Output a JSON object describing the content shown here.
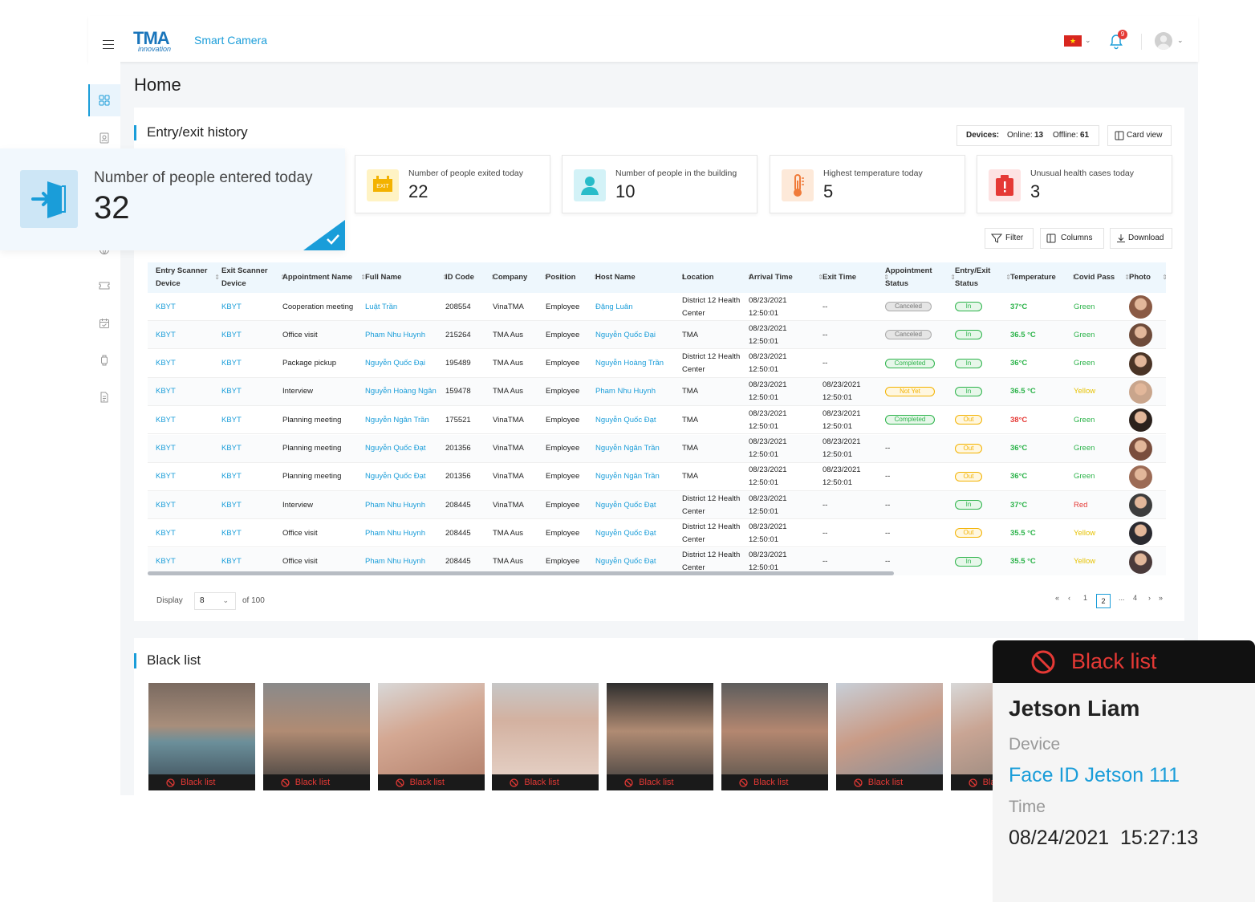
{
  "header": {
    "logo_text": "TMA",
    "logo_sub": "innovation",
    "app_name": "Smart Camera",
    "notification_count": "9"
  },
  "page": {
    "title": "Home"
  },
  "entry_exit": {
    "title": "Entry/exit history",
    "devices_label": "Devices:",
    "online_label": "Online:",
    "online_value": "13",
    "offline_label": "Offline:",
    "offline_value": "61",
    "card_view_label": "Card view",
    "stats": [
      {
        "label": "Number of people entered today",
        "value": "32",
        "icon": "enter-door-icon"
      },
      {
        "label": "Number of people exited today",
        "value": "22",
        "icon": "exit-sign-icon"
      },
      {
        "label": "Number of people in the building",
        "value": "10",
        "icon": "person-icon"
      },
      {
        "label": "Highest temperature today",
        "value": "5",
        "icon": "thermometer-icon"
      },
      {
        "label": "Unusual health cases today",
        "value": "3",
        "icon": "alert-box-icon"
      }
    ],
    "toolbar": {
      "filter": "Filter",
      "columns": "Columns",
      "download": "Download"
    },
    "columns": [
      "Entry Scanner Device",
      "Exit Scanner Device",
      "Appointment Name",
      "Full Name",
      "ID Code",
      "Company",
      "Position",
      "Host Name",
      "Location",
      "Arrival Time",
      "Exit Time",
      "Appointment Status",
      "Entry/Exit Status",
      "Temperature",
      "Covid Pass",
      "Photo"
    ],
    "rows": [
      {
        "entry": "KBYT",
        "exit": "KBYT",
        "appt": "Cooperation meeting",
        "name": "Luật Trần",
        "id": "208554",
        "company": "VinaTMA",
        "position": "Employee",
        "host": "Đặng Luân",
        "location": "District 12 Health Center",
        "arrival_date": "08/23/2021",
        "arrival_time": "12:50:01",
        "exit_date": "--",
        "exit_time": "",
        "status": "Canceled",
        "io": "In",
        "temp": "37°C",
        "covid": "Green"
      },
      {
        "entry": "KBYT",
        "exit": "KBYT",
        "appt": "Office visit",
        "name": "Pham  Nhu Huynh",
        "id": "215264",
        "company": "TMA Aus",
        "position": "Employee",
        "host": "Nguyễn Quốc Đại",
        "location": "TMA",
        "arrival_date": "08/23/2021",
        "arrival_time": "12:50:01",
        "exit_date": "--",
        "exit_time": "",
        "status": "Canceled",
        "io": "In",
        "temp": "36.5 °C",
        "covid": "Green"
      },
      {
        "entry": "KBYT",
        "exit": "KBYT",
        "appt": "Package pickup",
        "name": "Nguyễn Quốc Đại",
        "id": "195489",
        "company": "TMA Aus",
        "position": "Employee",
        "host": "Nguyễn Hoàng Trần",
        "location": "District 12 Health Center",
        "arrival_date": "08/23/2021",
        "arrival_time": "12:50:01",
        "exit_date": "--",
        "exit_time": "",
        "status": "Completed",
        "io": "In",
        "temp": "36°C",
        "covid": "Green"
      },
      {
        "entry": "KBYT",
        "exit": "KBYT",
        "appt": "Interview",
        "name": "Nguyễn Hoàng Ngân",
        "id": "159478",
        "company": "TMA Aus",
        "position": "Employee",
        "host": "Pham Nhu Huynh",
        "location": "TMA",
        "arrival_date": "08/23/2021",
        "arrival_time": "12:50:01",
        "exit_date": "08/23/2021",
        "exit_time": "12:50:01",
        "status": "Not Yet",
        "io": "In",
        "temp": "36.5 °C",
        "covid": "Yellow"
      },
      {
        "entry": "KBYT",
        "exit": "KBYT",
        "appt": "Planning meeting",
        "name": "Nguyễn Ngân Trần",
        "id": "175521",
        "company": "VinaTMA",
        "position": "Employee",
        "host": "Nguyễn Quốc Đạt",
        "location": "TMA",
        "arrival_date": "08/23/2021",
        "arrival_time": "12:50:01",
        "exit_date": "08/23/2021",
        "exit_time": "12:50:01",
        "status": "Completed",
        "io": "Out",
        "temp": "38°C",
        "covid": "Green"
      },
      {
        "entry": "KBYT",
        "exit": "KBYT",
        "appt": "Planning meeting",
        "name": "Nguyễn Quốc Đạt",
        "id": "201356",
        "company": "VinaTMA",
        "position": "Employee",
        "host": "Nguyễn Ngân Trần",
        "location": "TMA",
        "arrival_date": "08/23/2021",
        "arrival_time": "12:50:01",
        "exit_date": "08/23/2021",
        "exit_time": "12:50:01",
        "status": "--",
        "io": "Out",
        "temp": "36°C",
        "covid": "Green"
      },
      {
        "entry": "KBYT",
        "exit": "KBYT",
        "appt": "Planning meeting",
        "name": "Nguyễn Quốc Đạt",
        "id": "201356",
        "company": "VinaTMA",
        "position": "Employee",
        "host": "Nguyễn Ngân Trần",
        "location": "TMA",
        "arrival_date": "08/23/2021",
        "arrival_time": "12:50:01",
        "exit_date": "08/23/2021",
        "exit_time": "12:50:01",
        "status": "--",
        "io": "Out",
        "temp": "36°C",
        "covid": "Green"
      },
      {
        "entry": "KBYT",
        "exit": "KBYT",
        "appt": "Interview",
        "name": "Pham Nhu Huynh",
        "id": "208445",
        "company": "VinaTMA",
        "position": "Employee",
        "host": "Nguyễn Quốc Đạt",
        "location": "District 12 Health Center",
        "arrival_date": "08/23/2021",
        "arrival_time": "12:50:01",
        "exit_date": "--",
        "exit_time": "",
        "status": "--",
        "io": "In",
        "temp": "37°C",
        "covid": "Red"
      },
      {
        "entry": "KBYT",
        "exit": "KBYT",
        "appt": "Office visit",
        "name": "Pham Nhu Huynh",
        "id": "208445",
        "company": "TMA Aus",
        "position": "Employee",
        "host": "Nguyễn Quốc Đạt",
        "location": "District 12 Health Center",
        "arrival_date": "08/23/2021",
        "arrival_time": "12:50:01",
        "exit_date": "--",
        "exit_time": "",
        "status": "--",
        "io": "Out",
        "temp": "35.5 °C",
        "covid": "Yellow"
      },
      {
        "entry": "KBYT",
        "exit": "KBYT",
        "appt": "Office visit",
        "name": "Pham Nhu Huynh",
        "id": "208445",
        "company": "TMA Aus",
        "position": "Employee",
        "host": "Nguyễn Quốc Đạt",
        "location": "District 12 Health Center",
        "arrival_date": "08/23/2021",
        "arrival_time": "12:50:01",
        "exit_date": "--",
        "exit_time": "",
        "status": "--",
        "io": "In",
        "temp": "35.5 °C",
        "covid": "Yellow"
      }
    ],
    "pagination": {
      "display_label": "Display",
      "page_size": "8",
      "of_label": "of",
      "total": "100",
      "pages": [
        "1",
        "2",
        "...",
        "4"
      ],
      "current": "2"
    }
  },
  "blacklist": {
    "title": "Black list",
    "caption": "Black list",
    "count_visible": 8
  },
  "popup": {
    "title": "Black list",
    "name": "Jetson Liam",
    "device_label": "Device",
    "device_value": "Face ID Jetson 111",
    "time_label": "Time",
    "time_value": "08/24/2021  15:27:13"
  },
  "colors": {
    "accent": "#1a9dd9",
    "danger": "#e53935",
    "success": "#2cb34a",
    "warning": "#f3b200"
  }
}
